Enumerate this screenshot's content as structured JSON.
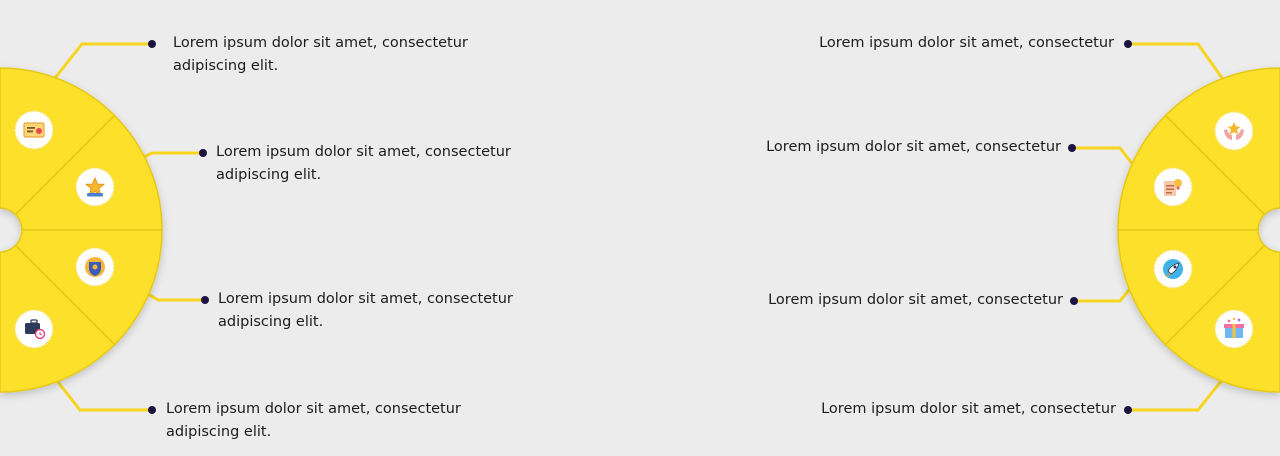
{
  "colors": {
    "background": "#ececec",
    "segment": "#fde02a",
    "segment_edge": "#d9bc12",
    "connector": "#f7d51e",
    "dot": "#1d1340",
    "text": "#1c1c1c"
  },
  "left_items": [
    {
      "text": "Lorem ipsum dolor sit amet, consectetur adipiscing elit.",
      "icon": "certificate-icon"
    },
    {
      "text": "Lorem ipsum dolor sit amet, consectetur adipiscing elit.",
      "icon": "star-badge-icon"
    },
    {
      "text": "Lorem ipsum dolor sit amet, consectetur adipiscing elit.",
      "icon": "shield-emblem-icon"
    },
    {
      "text": "Lorem ipsum dolor sit amet, consectetur adipiscing elit.",
      "icon": "briefcase-clock-icon"
    }
  ],
  "right_items": [
    {
      "text": "Lorem ipsum dolor sit amet, consectetur",
      "icon": "hands-star-icon"
    },
    {
      "text": "Lorem ipsum dolor sit amet, consectetur",
      "icon": "idea-document-icon"
    },
    {
      "text": "Lorem ipsum dolor sit amet, consectetur",
      "icon": "rocket-icon"
    },
    {
      "text": "Lorem ipsum dolor sit amet, consectetur",
      "icon": "gift-box-icon"
    }
  ]
}
